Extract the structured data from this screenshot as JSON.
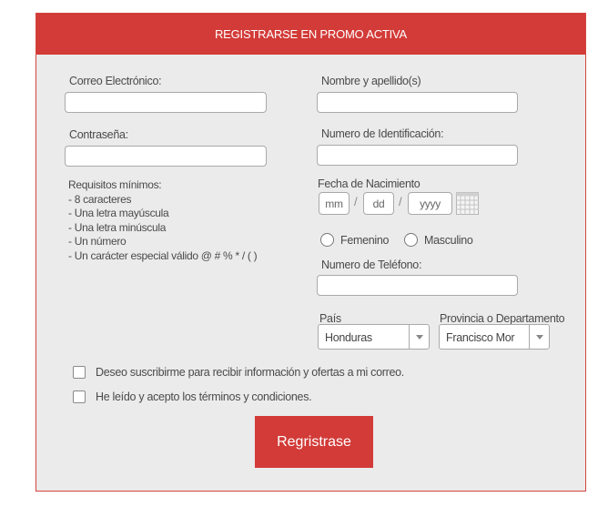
{
  "form": {
    "title": "REGISTRARSE EN PROMO ACTIVA",
    "email_label": "Correo Electrónico:",
    "password_label": "Contraseña:",
    "requirements": {
      "title": "Requisitos mínimos:",
      "items": [
        "- 8 caracteres",
        "- Una letra mayúscula",
        "- Una letra minúscula",
        "- Un número",
        "- Un carácter especial válido @ # % * / ( )"
      ]
    },
    "name_label": "Nombre y apellido(s)",
    "id_label": "Numero de Identificación:",
    "birthdate_label": "Fecha de Nacimiento",
    "date": {
      "mm": "mm",
      "dd": "dd",
      "yyyy": "yyyy",
      "sep": "/"
    },
    "gender": {
      "female": "Femenino",
      "male": "Masculino"
    },
    "phone_label": "Numero de Teléfono:",
    "country_label": "País",
    "country_value": "Honduras",
    "province_label": "Provincia o Departamento",
    "province_value": "Francisco Mor",
    "subscribe_label": "Deseo suscribirme para recibir información y ofertas a mi correo.",
    "terms_label": "He leído y acepto los términos y condiciones.",
    "submit_label": "Regristrase"
  },
  "colors": {
    "accent": "#d23b38",
    "panel": "#ebebeb"
  }
}
